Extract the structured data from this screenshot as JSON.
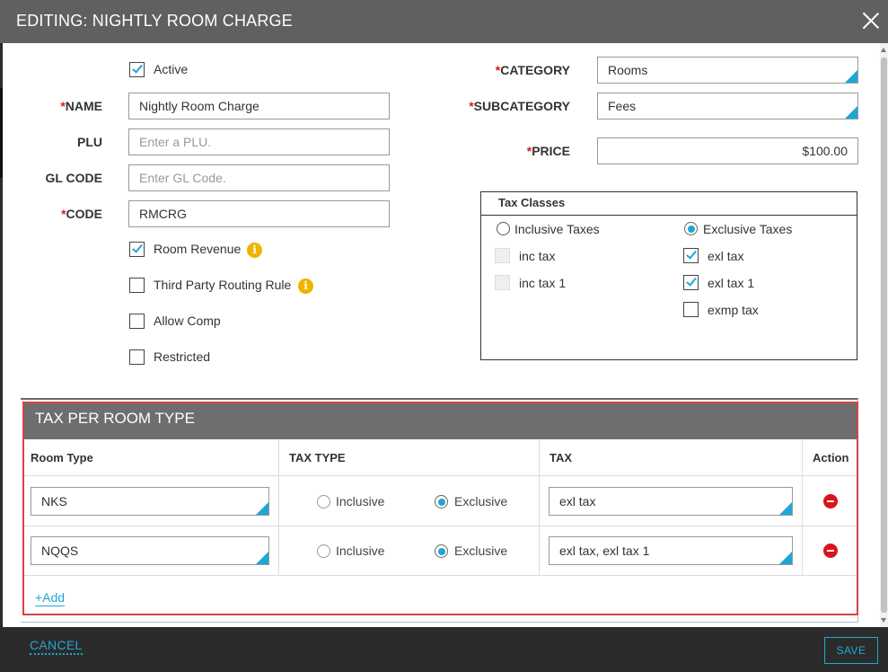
{
  "header": {
    "title": "EDITING: NIGHTLY ROOM CHARGE"
  },
  "form": {
    "active_label": "Active",
    "name": {
      "label": "NAME",
      "value": "Nightly Room Charge"
    },
    "plu": {
      "label": "PLU",
      "placeholder": "Enter a PLU."
    },
    "gl_code": {
      "label": "GL CODE",
      "placeholder": "Enter GL Code."
    },
    "code": {
      "label": "CODE",
      "value": "RMCRG"
    },
    "required_mark": "*",
    "checkboxes": {
      "room_revenue": "Room Revenue",
      "third_party": "Third Party Routing Rule",
      "allow_comp": "Allow Comp",
      "restricted": "Restricted"
    },
    "category": {
      "label": "CATEGORY",
      "value": "Rooms"
    },
    "subcategory": {
      "label": "SUBCATEGORY",
      "value": "Fees"
    },
    "price": {
      "label": "PRICE",
      "value": "$100.00"
    }
  },
  "tax_classes": {
    "title": "Tax Classes",
    "inclusive_label": "Inclusive Taxes",
    "exclusive_label": "Exclusive Taxes",
    "inclusive_items": [
      "inc tax",
      "inc tax 1"
    ],
    "exclusive_items": [
      "exl tax",
      "exl tax 1",
      "exmp tax"
    ]
  },
  "tax_per_room": {
    "title": "TAX PER ROOM TYPE",
    "columns": [
      "Room Type",
      "TAX TYPE",
      "TAX",
      "Action"
    ],
    "inclusive_label": "Inclusive",
    "exclusive_label": "Exclusive",
    "rows": [
      {
        "room_type": "NKS",
        "tax": "exl tax"
      },
      {
        "room_type": "NQQS",
        "tax": "exl tax, exl tax 1"
      }
    ],
    "add_label": "+Add"
  },
  "footer": {
    "cancel_label": "CANCEL",
    "save_label": "SAVE"
  },
  "colors": {
    "accent": "#1da8d4",
    "required": "#e0151b",
    "header_bg": "#606060",
    "footer_bg": "#2b2b2b",
    "highlight_border": "#d94141",
    "info": "#f0b300"
  }
}
